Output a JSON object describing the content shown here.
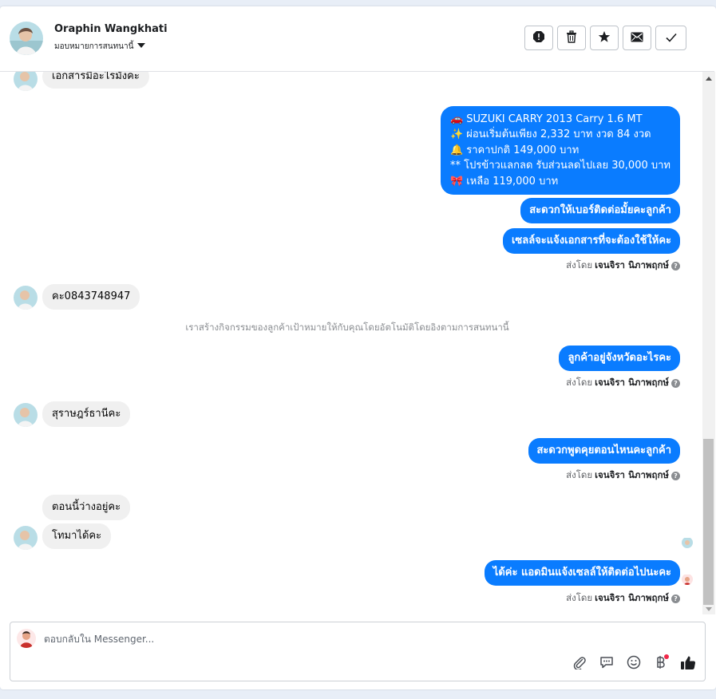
{
  "header": {
    "contact_name": "Oraphin Wangkhati",
    "assign_label": "มอบหมายการสนทนานี้",
    "actions": [
      {
        "name": "spam-icon"
      },
      {
        "name": "trash-icon"
      },
      {
        "name": "star-icon"
      },
      {
        "name": "envelope-icon"
      },
      {
        "name": "check-icon"
      }
    ]
  },
  "messages": {
    "in_1": "เอกสารมีอะไรมั้งคะ",
    "out_listing": [
      "🚗 SUZUKI CARRY 2013 Carry 1.6 MT",
      "✨ ผ่อนเริ่มต้นเพียง 2,332 บาท งวด 84 งวด",
      "🔔  ราคาปกติ 149,000 บาท",
      "** โปรข้าวแลกลด รับส่วนลดไปเลย 30,000 บาท",
      "🎀 เหลือ 119,000 บาท"
    ],
    "out_2": "สะดวกให้เบอร์ติดต่อมั้ยคะลูกค้า",
    "out_3": "เซลล์จะแจ้งเอกสารที่จะต้องใช้ให้คะ",
    "in_2": "คะ0843748947",
    "system_note": "เราสร้างกิจกรรมของลูกค้าเป้าหมายให้กับคุณโดยอัตโนมัติโดยอิงตามการสนทนานี้",
    "out_4": "ลูกค้าอยู่จังหวัดอะไรคะ",
    "in_3": "สุราษฎร์ธานีคะ",
    "out_5": "สะดวกพูดคุยตอนไหนคะลูกค้า",
    "in_4": "ตอนนี้ว่างอยู่คะ",
    "in_5": "โทมาได้คะ",
    "out_6": "ได้ค่ะ แอดมินแจ้งเซลล์ให้ติดต่อไปนะคะ"
  },
  "sent_by": {
    "prefix": "ส่งโดย",
    "agent": "เจนจิรา นิภาพฤกษ์"
  },
  "composer": {
    "placeholder": "ตอบกลับใน Messenger..."
  },
  "colors": {
    "outgoing_bubble": "#0a7cff",
    "incoming_bubble": "#f0f0f0",
    "notification_dot": "#f02849"
  }
}
